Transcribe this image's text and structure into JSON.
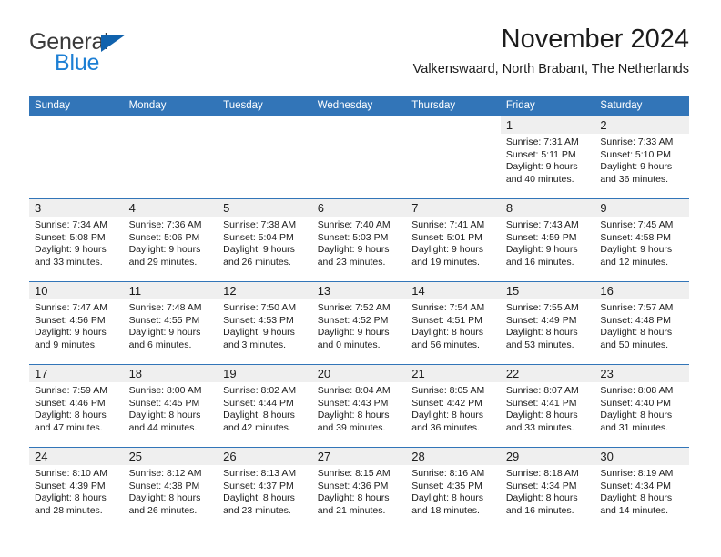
{
  "logo": {
    "word_one": "General",
    "word_two": "Blue",
    "triangle_icon": "triangle-icon",
    "accent_blue": "#1d7fd4",
    "triangle_blue": "#1062ad"
  },
  "header": {
    "title": "November 2024",
    "subtitle": "Valkenswaard, North Brabant, The Netherlands"
  },
  "theme": {
    "header_blue": "#3275b8",
    "daynum_band": "#efefef",
    "text": "#1c1c1c"
  },
  "weekdays": [
    "Sunday",
    "Monday",
    "Tuesday",
    "Wednesday",
    "Thursday",
    "Friday",
    "Saturday"
  ],
  "weeks": [
    [
      {
        "day": "",
        "sunrise": "",
        "sunset": "",
        "daylight1": "",
        "daylight2": "",
        "empty": true
      },
      {
        "day": "",
        "sunrise": "",
        "sunset": "",
        "daylight1": "",
        "daylight2": "",
        "empty": true
      },
      {
        "day": "",
        "sunrise": "",
        "sunset": "",
        "daylight1": "",
        "daylight2": "",
        "empty": true
      },
      {
        "day": "",
        "sunrise": "",
        "sunset": "",
        "daylight1": "",
        "daylight2": "",
        "empty": true
      },
      {
        "day": "",
        "sunrise": "",
        "sunset": "",
        "daylight1": "",
        "daylight2": "",
        "empty": true
      },
      {
        "day": "1",
        "sunrise": "Sunrise: 7:31 AM",
        "sunset": "Sunset: 5:11 PM",
        "daylight1": "Daylight: 9 hours",
        "daylight2": "and 40 minutes.",
        "empty": false
      },
      {
        "day": "2",
        "sunrise": "Sunrise: 7:33 AM",
        "sunset": "Sunset: 5:10 PM",
        "daylight1": "Daylight: 9 hours",
        "daylight2": "and 36 minutes.",
        "empty": false
      }
    ],
    [
      {
        "day": "3",
        "sunrise": "Sunrise: 7:34 AM",
        "sunset": "Sunset: 5:08 PM",
        "daylight1": "Daylight: 9 hours",
        "daylight2": "and 33 minutes.",
        "empty": false
      },
      {
        "day": "4",
        "sunrise": "Sunrise: 7:36 AM",
        "sunset": "Sunset: 5:06 PM",
        "daylight1": "Daylight: 9 hours",
        "daylight2": "and 29 minutes.",
        "empty": false
      },
      {
        "day": "5",
        "sunrise": "Sunrise: 7:38 AM",
        "sunset": "Sunset: 5:04 PM",
        "daylight1": "Daylight: 9 hours",
        "daylight2": "and 26 minutes.",
        "empty": false
      },
      {
        "day": "6",
        "sunrise": "Sunrise: 7:40 AM",
        "sunset": "Sunset: 5:03 PM",
        "daylight1": "Daylight: 9 hours",
        "daylight2": "and 23 minutes.",
        "empty": false
      },
      {
        "day": "7",
        "sunrise": "Sunrise: 7:41 AM",
        "sunset": "Sunset: 5:01 PM",
        "daylight1": "Daylight: 9 hours",
        "daylight2": "and 19 minutes.",
        "empty": false
      },
      {
        "day": "8",
        "sunrise": "Sunrise: 7:43 AM",
        "sunset": "Sunset: 4:59 PM",
        "daylight1": "Daylight: 9 hours",
        "daylight2": "and 16 minutes.",
        "empty": false
      },
      {
        "day": "9",
        "sunrise": "Sunrise: 7:45 AM",
        "sunset": "Sunset: 4:58 PM",
        "daylight1": "Daylight: 9 hours",
        "daylight2": "and 12 minutes.",
        "empty": false
      }
    ],
    [
      {
        "day": "10",
        "sunrise": "Sunrise: 7:47 AM",
        "sunset": "Sunset: 4:56 PM",
        "daylight1": "Daylight: 9 hours",
        "daylight2": "and 9 minutes.",
        "empty": false
      },
      {
        "day": "11",
        "sunrise": "Sunrise: 7:48 AM",
        "sunset": "Sunset: 4:55 PM",
        "daylight1": "Daylight: 9 hours",
        "daylight2": "and 6 minutes.",
        "empty": false
      },
      {
        "day": "12",
        "sunrise": "Sunrise: 7:50 AM",
        "sunset": "Sunset: 4:53 PM",
        "daylight1": "Daylight: 9 hours",
        "daylight2": "and 3 minutes.",
        "empty": false
      },
      {
        "day": "13",
        "sunrise": "Sunrise: 7:52 AM",
        "sunset": "Sunset: 4:52 PM",
        "daylight1": "Daylight: 9 hours",
        "daylight2": "and 0 minutes.",
        "empty": false
      },
      {
        "day": "14",
        "sunrise": "Sunrise: 7:54 AM",
        "sunset": "Sunset: 4:51 PM",
        "daylight1": "Daylight: 8 hours",
        "daylight2": "and 56 minutes.",
        "empty": false
      },
      {
        "day": "15",
        "sunrise": "Sunrise: 7:55 AM",
        "sunset": "Sunset: 4:49 PM",
        "daylight1": "Daylight: 8 hours",
        "daylight2": "and 53 minutes.",
        "empty": false
      },
      {
        "day": "16",
        "sunrise": "Sunrise: 7:57 AM",
        "sunset": "Sunset: 4:48 PM",
        "daylight1": "Daylight: 8 hours",
        "daylight2": "and 50 minutes.",
        "empty": false
      }
    ],
    [
      {
        "day": "17",
        "sunrise": "Sunrise: 7:59 AM",
        "sunset": "Sunset: 4:46 PM",
        "daylight1": "Daylight: 8 hours",
        "daylight2": "and 47 minutes.",
        "empty": false
      },
      {
        "day": "18",
        "sunrise": "Sunrise: 8:00 AM",
        "sunset": "Sunset: 4:45 PM",
        "daylight1": "Daylight: 8 hours",
        "daylight2": "and 44 minutes.",
        "empty": false
      },
      {
        "day": "19",
        "sunrise": "Sunrise: 8:02 AM",
        "sunset": "Sunset: 4:44 PM",
        "daylight1": "Daylight: 8 hours",
        "daylight2": "and 42 minutes.",
        "empty": false
      },
      {
        "day": "20",
        "sunrise": "Sunrise: 8:04 AM",
        "sunset": "Sunset: 4:43 PM",
        "daylight1": "Daylight: 8 hours",
        "daylight2": "and 39 minutes.",
        "empty": false
      },
      {
        "day": "21",
        "sunrise": "Sunrise: 8:05 AM",
        "sunset": "Sunset: 4:42 PM",
        "daylight1": "Daylight: 8 hours",
        "daylight2": "and 36 minutes.",
        "empty": false
      },
      {
        "day": "22",
        "sunrise": "Sunrise: 8:07 AM",
        "sunset": "Sunset: 4:41 PM",
        "daylight1": "Daylight: 8 hours",
        "daylight2": "and 33 minutes.",
        "empty": false
      },
      {
        "day": "23",
        "sunrise": "Sunrise: 8:08 AM",
        "sunset": "Sunset: 4:40 PM",
        "daylight1": "Daylight: 8 hours",
        "daylight2": "and 31 minutes.",
        "empty": false
      }
    ],
    [
      {
        "day": "24",
        "sunrise": "Sunrise: 8:10 AM",
        "sunset": "Sunset: 4:39 PM",
        "daylight1": "Daylight: 8 hours",
        "daylight2": "and 28 minutes.",
        "empty": false
      },
      {
        "day": "25",
        "sunrise": "Sunrise: 8:12 AM",
        "sunset": "Sunset: 4:38 PM",
        "daylight1": "Daylight: 8 hours",
        "daylight2": "and 26 minutes.",
        "empty": false
      },
      {
        "day": "26",
        "sunrise": "Sunrise: 8:13 AM",
        "sunset": "Sunset: 4:37 PM",
        "daylight1": "Daylight: 8 hours",
        "daylight2": "and 23 minutes.",
        "empty": false
      },
      {
        "day": "27",
        "sunrise": "Sunrise: 8:15 AM",
        "sunset": "Sunset: 4:36 PM",
        "daylight1": "Daylight: 8 hours",
        "daylight2": "and 21 minutes.",
        "empty": false
      },
      {
        "day": "28",
        "sunrise": "Sunrise: 8:16 AM",
        "sunset": "Sunset: 4:35 PM",
        "daylight1": "Daylight: 8 hours",
        "daylight2": "and 18 minutes.",
        "empty": false
      },
      {
        "day": "29",
        "sunrise": "Sunrise: 8:18 AM",
        "sunset": "Sunset: 4:34 PM",
        "daylight1": "Daylight: 8 hours",
        "daylight2": "and 16 minutes.",
        "empty": false
      },
      {
        "day": "30",
        "sunrise": "Sunrise: 8:19 AM",
        "sunset": "Sunset: 4:34 PM",
        "daylight1": "Daylight: 8 hours",
        "daylight2": "and 14 minutes.",
        "empty": false
      }
    ]
  ]
}
